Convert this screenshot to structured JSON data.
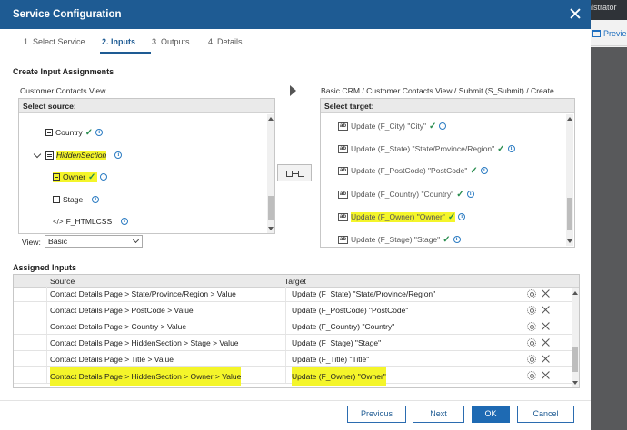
{
  "background": {
    "top_text": "nistrator",
    "preview_label": "Previe"
  },
  "dialog": {
    "title": "Service Configuration",
    "close_icon": "close-icon"
  },
  "wizard_tabs": [
    {
      "label": "1. Select Service",
      "active": false
    },
    {
      "label": "2. Inputs",
      "active": true
    },
    {
      "label": "3. Outputs",
      "active": false
    },
    {
      "label": "4. Details",
      "active": false
    }
  ],
  "section_title": "Create Input Assignments",
  "source": {
    "view_name": "Customer Contacts View",
    "panel_header": "Select source:",
    "items": [
      {
        "label": "Country",
        "icon": "minus-box-icon",
        "checked": true
      },
      {
        "label": "HiddenSection",
        "icon": "section-icon",
        "checked": false
      },
      {
        "label": "Owner",
        "icon": "minus-box-icon",
        "checked": true
      },
      {
        "label": "Stage",
        "icon": "minus-box-icon",
        "checked": false
      },
      {
        "label": "F_HTMLCSS",
        "icon": "code-icon",
        "checked": false
      }
    ],
    "view_label": "View:",
    "view_value": "Basic"
  },
  "target": {
    "path": "Basic CRM / Customer Contacts View / Submit (S_Submit) / Create",
    "panel_header": "Select target:",
    "items": [
      {
        "label": "Update (F_City) \"City\""
      },
      {
        "label": "Update (F_State) \"State/Province/Region\""
      },
      {
        "label": "Update (F_PostCode) \"PostCode\""
      },
      {
        "label": "Update (F_Country) \"Country\""
      },
      {
        "label": "Update (F_Owner) \"Owner\""
      },
      {
        "label": "Update (F_Stage) \"Stage\""
      }
    ],
    "icon_text": "ab"
  },
  "assigned": {
    "title": "Assigned Inputs",
    "col_source": "Source",
    "col_target": "Target",
    "rows": [
      {
        "source": "Contact Details Page > State/Province/Region > Value",
        "target": "Update (F_State) \"State/Province/Region\""
      },
      {
        "source": "Contact Details Page > PostCode > Value",
        "target": "Update (F_PostCode) \"PostCode\""
      },
      {
        "source": "Contact Details Page > Country > Value",
        "target": "Update (F_Country) \"Country\""
      },
      {
        "source": "Contact Details Page > HiddenSection > Stage > Value",
        "target": "Update (F_Stage) \"Stage\""
      },
      {
        "source": "Contact Details Page > Title > Value",
        "target": "Update (F_Title) \"Title\""
      },
      {
        "source": "Contact Details Page > HiddenSection > Owner > Value",
        "target": "Update (F_Owner) \"Owner\""
      }
    ]
  },
  "buttons": {
    "previous": "Previous",
    "next": "Next",
    "ok": "OK",
    "cancel": "Cancel"
  },
  "colors": {
    "title_bar": "#1e5b93",
    "highlight": "#f4f52a",
    "check": "#2a8d4f",
    "info": "#2b7bc2"
  }
}
